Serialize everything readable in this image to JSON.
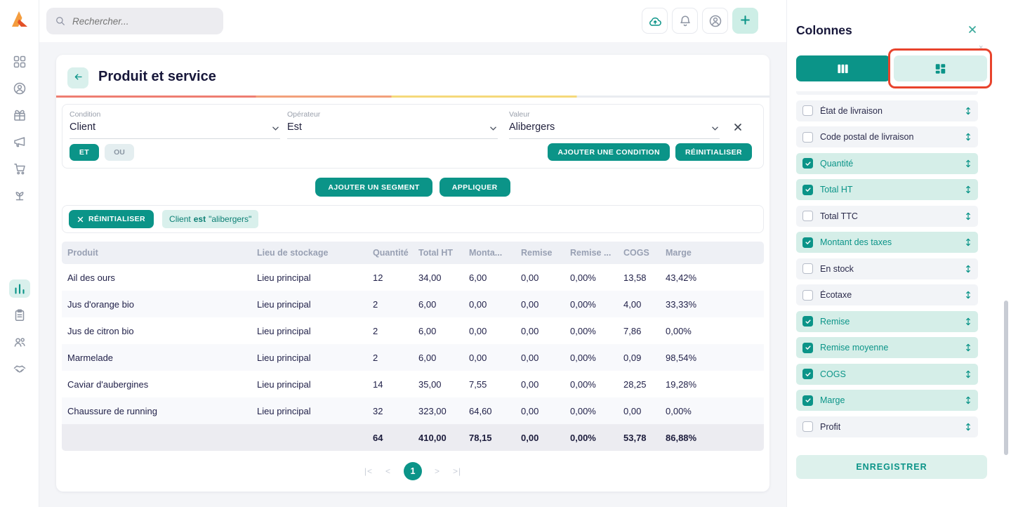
{
  "colors": {
    "accent": "#0b9488",
    "accent_light": "#d9f0ec",
    "annotation_red": "#e8432c"
  },
  "topbar": {
    "search": {
      "placeholder": "Rechercher..."
    },
    "icons": [
      "cloud-upload",
      "bell",
      "user-circle",
      "plus"
    ]
  },
  "sidebar": {
    "icons": [
      "apps-grid",
      "user-circle",
      "gift",
      "megaphone",
      "cart",
      "plant",
      "bar-chart",
      "clipboard",
      "users",
      "handshake"
    ],
    "active_icon": "bar-chart"
  },
  "main": {
    "title": "Produit et service",
    "filter": {
      "condition_label": "Condition",
      "condition_value": "Client",
      "operator_label": "Opérateur",
      "operator_value": "Est",
      "value_label": "Valeur",
      "value_value": "Alibergers",
      "and_label": "ET",
      "or_label": "OU",
      "add_condition_label": "AJOUTER UNE CONDITION",
      "reset_label": "RÉINITIALISER"
    },
    "actions": {
      "add_segment_label": "AJOUTER UN SEGMENT",
      "apply_label": "APPLIQUER"
    },
    "chipbar": {
      "reset_label": "RÉINITIALISER",
      "chip": {
        "field": "Client",
        "operator": "est",
        "value": "\"alibergers\""
      }
    },
    "table": {
      "headers": [
        "Produit",
        "Lieu de stockage",
        "Quantité",
        "Total HT",
        "Monta...",
        "Remise",
        "Remise ...",
        "COGS",
        "Marge"
      ],
      "rows": [
        [
          "Ail des ours",
          "Lieu principal",
          "12",
          "34,00",
          "6,00",
          "0,00",
          "0,00%",
          "13,58",
          "43,42%"
        ],
        [
          "Jus d'orange bio",
          "Lieu principal",
          "2",
          "6,00",
          "0,00",
          "0,00",
          "0,00%",
          "4,00",
          "33,33%"
        ],
        [
          "Jus de citron bio",
          "Lieu principal",
          "2",
          "6,00",
          "0,00",
          "0,00",
          "0,00%",
          "7,86",
          "0,00%"
        ],
        [
          "Marmelade",
          "Lieu principal",
          "2",
          "6,00",
          "0,00",
          "0,00",
          "0,00%",
          "0,09",
          "98,54%"
        ],
        [
          "Caviar d'aubergines",
          "Lieu principal",
          "14",
          "35,00",
          "7,55",
          "0,00",
          "0,00%",
          "28,25",
          "19,28%"
        ],
        [
          "Chaussure de running",
          "Lieu principal",
          "32",
          "323,00",
          "64,60",
          "0,00",
          "0,00%",
          "0,00",
          "0,00%"
        ]
      ],
      "total_row": [
        "",
        "",
        "64",
        "410,00",
        "78,15",
        "0,00",
        "0,00%",
        "53,78",
        "86,88%"
      ]
    },
    "pagination": {
      "first": "|<",
      "prev": "<",
      "current": "1",
      "next": ">",
      "last": ">|"
    }
  },
  "panel": {
    "title": "Colonnes",
    "save_label": "ENREGISTRER",
    "tabs": [
      "columns-view",
      "cards-view"
    ],
    "columns": [
      {
        "label": "État de livraison",
        "checked": false
      },
      {
        "label": "Code postal de livraison",
        "checked": false
      },
      {
        "label": "Quantité",
        "checked": true
      },
      {
        "label": "Total HT",
        "checked": true
      },
      {
        "label": "Total TTC",
        "checked": false
      },
      {
        "label": "Montant des taxes",
        "checked": true
      },
      {
        "label": "En stock",
        "checked": false
      },
      {
        "label": "Écotaxe",
        "checked": false
      },
      {
        "label": "Remise",
        "checked": true
      },
      {
        "label": "Remise moyenne",
        "checked": true
      },
      {
        "label": "COGS",
        "checked": true
      },
      {
        "label": "Marge",
        "checked": true
      },
      {
        "label": "Profit",
        "checked": false
      }
    ]
  }
}
